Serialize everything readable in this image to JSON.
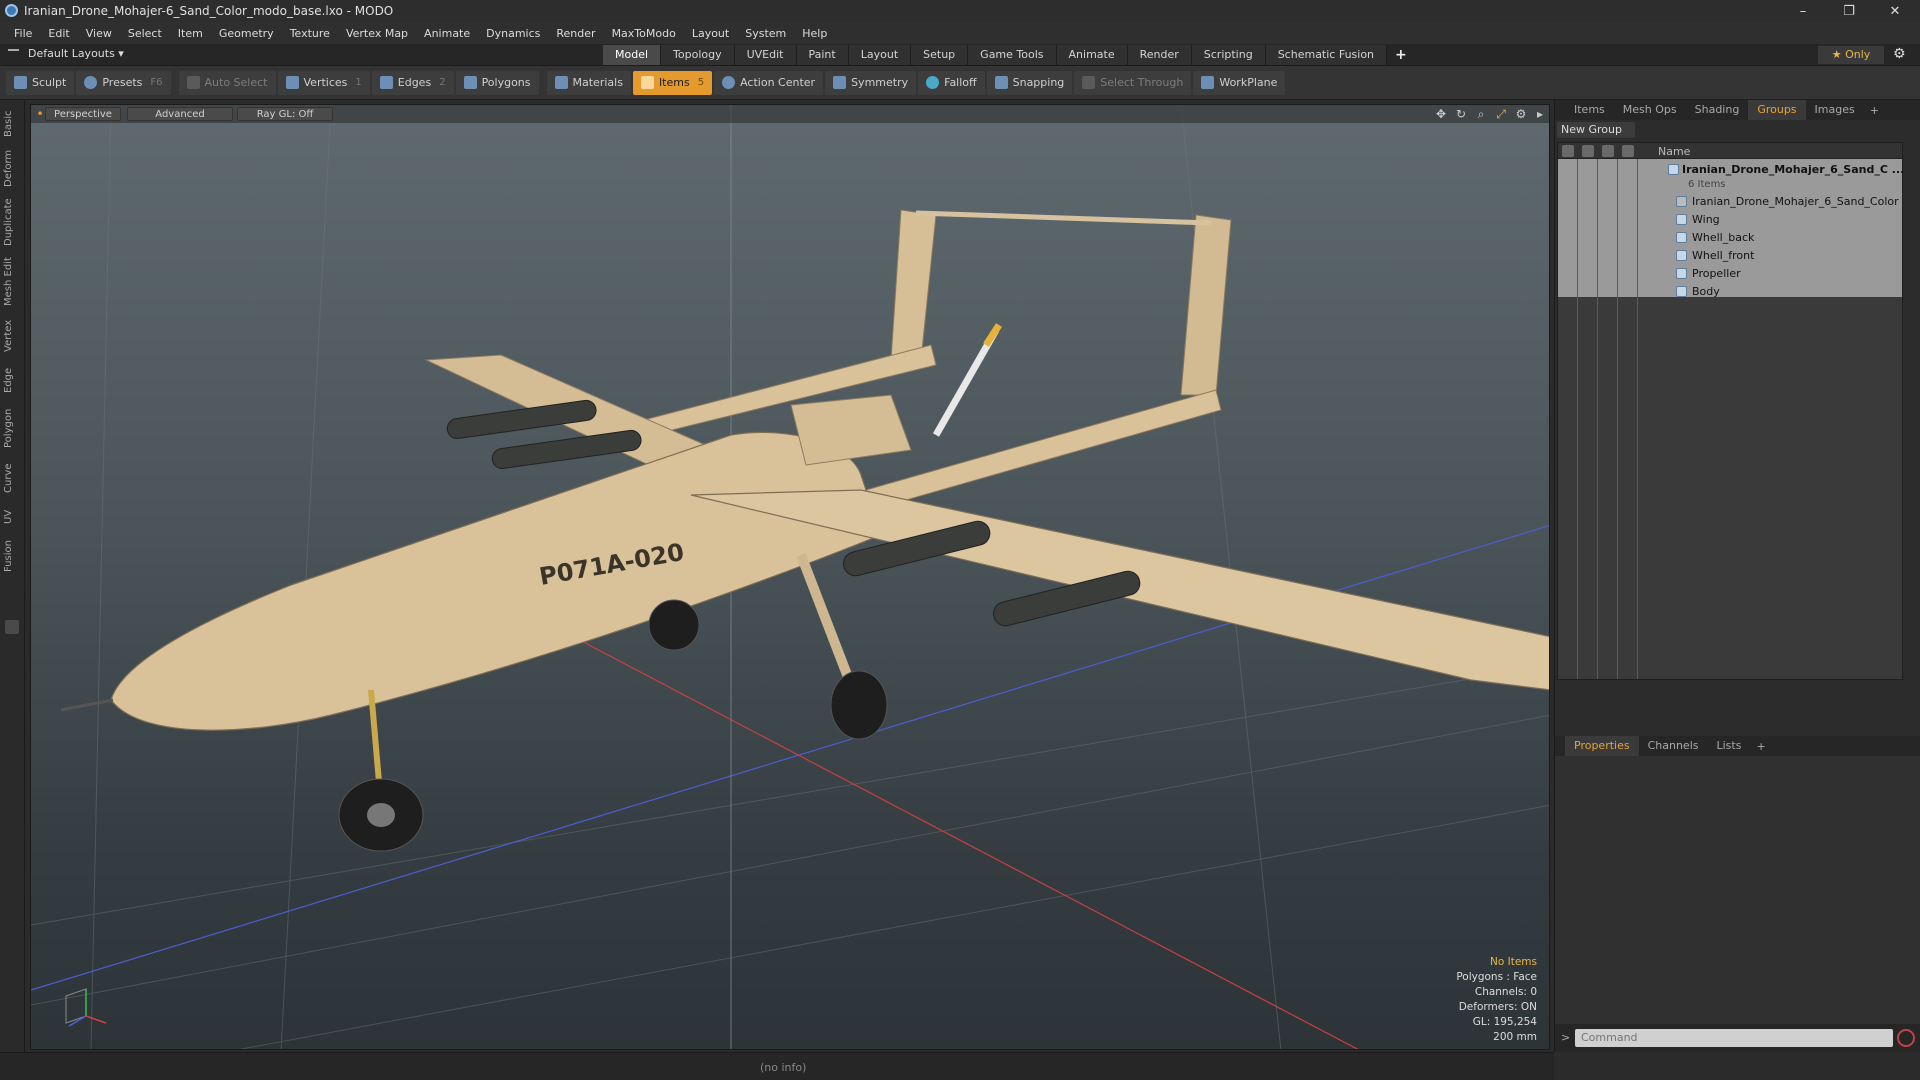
{
  "window": {
    "title": "Iranian_Drone_Mohajer-6_Sand_Color_modo_base.lxo - MODO",
    "minimize": "–",
    "restore": "❐",
    "close": "✕"
  },
  "menu": [
    "File",
    "Edit",
    "View",
    "Select",
    "Item",
    "Geometry",
    "Texture",
    "Vertex Map",
    "Animate",
    "Dynamics",
    "Render",
    "MaxToModo",
    "Layout",
    "System",
    "Help"
  ],
  "layout_selector": "Default Layouts ▾",
  "tabs": [
    "Model",
    "Topology",
    "UVEdit",
    "Paint",
    "Layout",
    "Setup",
    "Game Tools",
    "Animate",
    "Render",
    "Scripting",
    "Schematic Fusion"
  ],
  "tabs_plus": "+",
  "only_label": "★ Only",
  "toolbar": {
    "sculpt": "Sculpt",
    "presets": "Presets",
    "presets_key": "F6",
    "auto_select": "Auto Select",
    "vertices": "Vertices",
    "vertices_key": "1",
    "edges": "Edges",
    "edges_key": "2",
    "polygons": "Polygons",
    "materials": "Materials",
    "items": "Items",
    "items_key": "5",
    "action_center": "Action Center",
    "symmetry": "Symmetry",
    "falloff": "Falloff",
    "snapping": "Snapping",
    "select_through": "Select Through",
    "workplane": "WorkPlane"
  },
  "left_tabs": [
    "Basic",
    "Deform",
    "Duplicate",
    "Mesh Edit",
    "Vertex",
    "Edge",
    "Polygon",
    "Curve",
    "UV",
    "Fusion"
  ],
  "viewport": {
    "view": "Perspective",
    "shading": "Advanced",
    "raygl": "Ray GL: Off",
    "tail_number": "P071A-020",
    "info": {
      "no_items": "No Items",
      "polygons": "Polygons : Face",
      "channels": "Channels: 0",
      "deformers": "Deformers: ON",
      "gl": "GL: 195,254",
      "scale": "200 mm"
    }
  },
  "right_panel": {
    "tabs": [
      "Items",
      "Mesh Ops",
      "Shading",
      "Groups",
      "Images"
    ],
    "active_tab": "Groups",
    "tabs_plus": "+",
    "new_group": "New Group",
    "col_name": "Name",
    "group": {
      "name": "Iranian_Drone_Mohajer_6_Sand_C ...",
      "count": "6 Items"
    },
    "items": [
      "Iranian_Drone_Mohajer_6_Sand_Color",
      "Wing",
      "Whell_back",
      "Whell_front",
      "Propeller",
      "Body"
    ],
    "bottom_tabs": [
      "Properties",
      "Channels",
      "Lists"
    ],
    "bottom_active": "Properties",
    "command_placeholder": "Command",
    "prompt": ">"
  },
  "status": "(no info)",
  "colors": {
    "accent": "#e49a2c",
    "selection_text": "#e8b64a",
    "drone_body": "#d9c29a"
  }
}
